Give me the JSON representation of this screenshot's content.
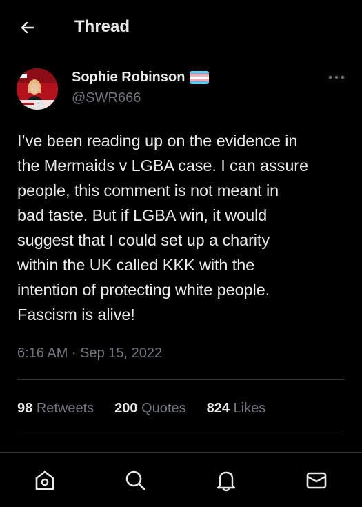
{
  "header": {
    "title": "Thread",
    "back_icon": "arrow-left-icon"
  },
  "author": {
    "display_name": "Sophie Robinson",
    "handle": "@SWR666",
    "flag_icon": "transgender-flag-icon",
    "more_icon": "more-dots-icon"
  },
  "tweet": {
    "lines": [
      "I’ve been reading up on the evidence in",
      "the Mermaids v LGBA case. I can assure",
      "people, this comment is not meant in",
      "bad taste. But if LGBA win, it would",
      "suggest that I could set up a charity",
      "within the UK called KKK with the",
      "intention of protecting white people.",
      "Fascism is alive!"
    ],
    "timestamp": "6:16 AM · Sep 15, 2022"
  },
  "stats": {
    "retweets_count": "98",
    "retweets_label": "Retweets",
    "quotes_count": "200",
    "quotes_label": "Quotes",
    "likes_count": "824",
    "likes_label": "Likes"
  },
  "bottom_nav": {
    "items": [
      "home-icon",
      "search-icon",
      "notifications-icon",
      "messages-icon"
    ]
  },
  "colors": {
    "background": "#000000",
    "text_primary": "#e7e9ea",
    "text_secondary": "#71767b",
    "divider": "#2f3336",
    "flag_blue": "#5bcefa",
    "flag_pink": "#f5a9b8",
    "flag_white": "#ffffff"
  }
}
